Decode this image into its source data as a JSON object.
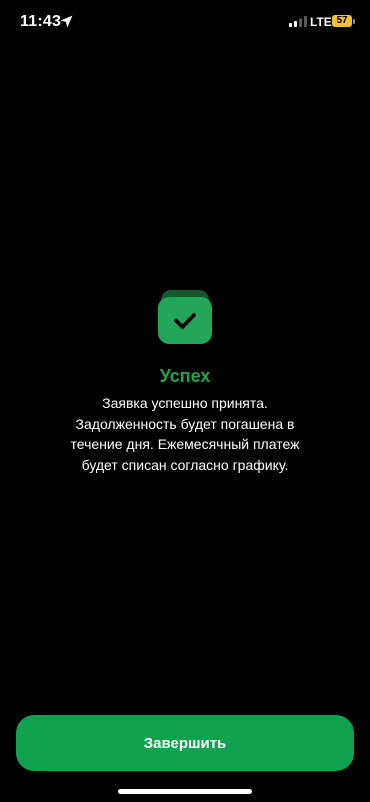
{
  "status_bar": {
    "time": "11:43",
    "network": "LTE",
    "battery_level": "57",
    "icons": [
      "location-arrow-icon",
      "cellular-signal-icon",
      "battery-icon"
    ]
  },
  "success": {
    "icon": "checkmark-icon",
    "title": "Успех",
    "message": "Заявка успешно принята. Задолженность будет погашена в течение дня. Ежемесячный платеж будет списан согласно графику."
  },
  "actions": {
    "finish_label": "Завершить"
  },
  "colors": {
    "background": "#000000",
    "accent_green": "#1fa54b",
    "button_green": "#0fa14e",
    "icon_back": "#145a2c",
    "icon_front": "#22a65a",
    "battery": "#f2c230"
  }
}
